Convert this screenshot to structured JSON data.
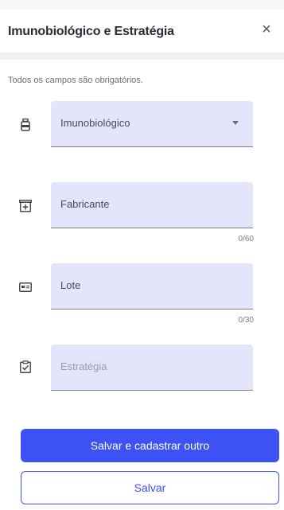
{
  "header": {
    "title": "Imunobiológico e Estratégia",
    "close_symbol": "×"
  },
  "form": {
    "required_note": "Todos os campos são obrigatórios.",
    "fields": [
      {
        "label": "Imunobiológico",
        "type": "select",
        "icon": "vaccine-bottle-icon",
        "value": ""
      },
      {
        "label": "Fabricante",
        "type": "text",
        "icon": "add-box-icon",
        "value": "",
        "counter": "0/60"
      },
      {
        "label": "Lote",
        "type": "text",
        "icon": "lot-card-icon",
        "value": "",
        "counter": "0/30"
      },
      {
        "label": "Estratégia",
        "type": "text",
        "icon": "clipboard-check-icon",
        "value": ""
      }
    ]
  },
  "actions": {
    "primary_label": "Salvar e cadastrar outro",
    "secondary_label": "Salvar"
  },
  "colors": {
    "accent": "#3d52f5",
    "field_bg": "#e4e4fb"
  }
}
